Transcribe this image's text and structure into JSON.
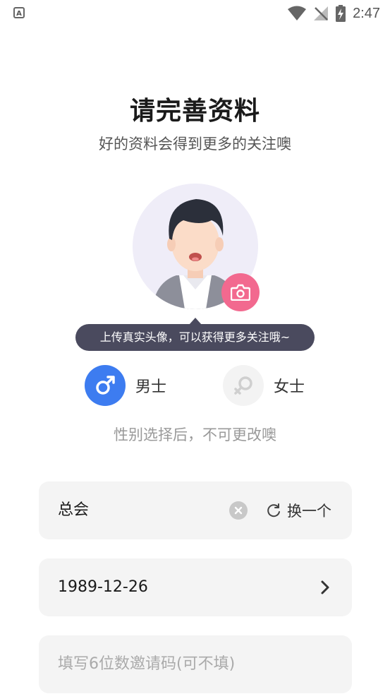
{
  "status_bar": {
    "time": "2:47",
    "app_badge": "A"
  },
  "header": {
    "title": "请完善资料",
    "subtitle": "好的资料会得到更多的关注噢"
  },
  "avatar": {
    "tooltip": "上传真实头像，可以获得更多关注哦~"
  },
  "gender": {
    "male_label": "男士",
    "female_label": "女士",
    "selected": "male",
    "hint": "性别选择后，不可更改噢"
  },
  "form": {
    "nickname_value": "总会",
    "refresh_label": "换一个",
    "birthday_value": "1989-12-26",
    "invite_placeholder": "填写6位数邀请码(可不填)"
  },
  "colors": {
    "accent_blue": "#3d7cf0",
    "camera_pink": "#f2698f",
    "tooltip_bg": "#4a4a5e"
  }
}
